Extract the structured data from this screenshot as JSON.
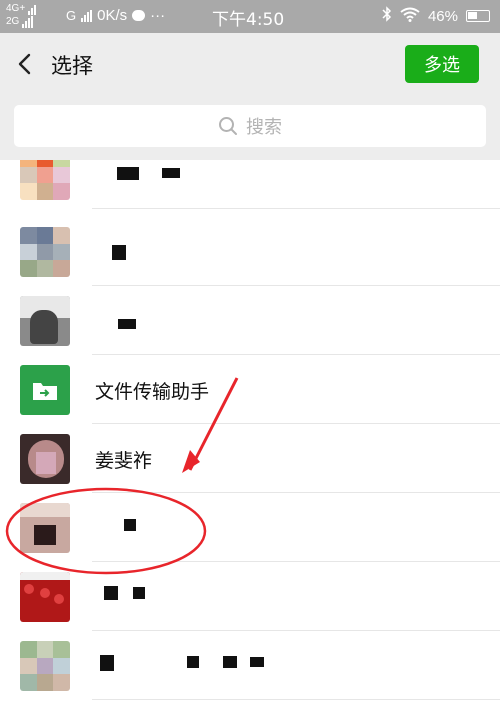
{
  "status_bar": {
    "network_top": "4G+",
    "network_bottom": "2G",
    "carrier_g": "G",
    "speed": "0K/s",
    "dots": "···",
    "time": "下午4:50",
    "battery": "46%"
  },
  "header": {
    "title": "选择",
    "multi_select": "多选"
  },
  "search": {
    "placeholder": "搜索"
  },
  "contacts": [
    {
      "name": ""
    },
    {
      "name": ""
    },
    {
      "name": ""
    },
    {
      "name": "文件传输助手"
    },
    {
      "name": "姜斐祚"
    },
    {
      "name": ""
    },
    {
      "name": ""
    },
    {
      "name": ""
    }
  ],
  "colors": {
    "accent_green": "#1aad19",
    "annotation_red": "#e8252b",
    "status_bar": "#a9a9a9",
    "nav_bg": "#ededed"
  }
}
